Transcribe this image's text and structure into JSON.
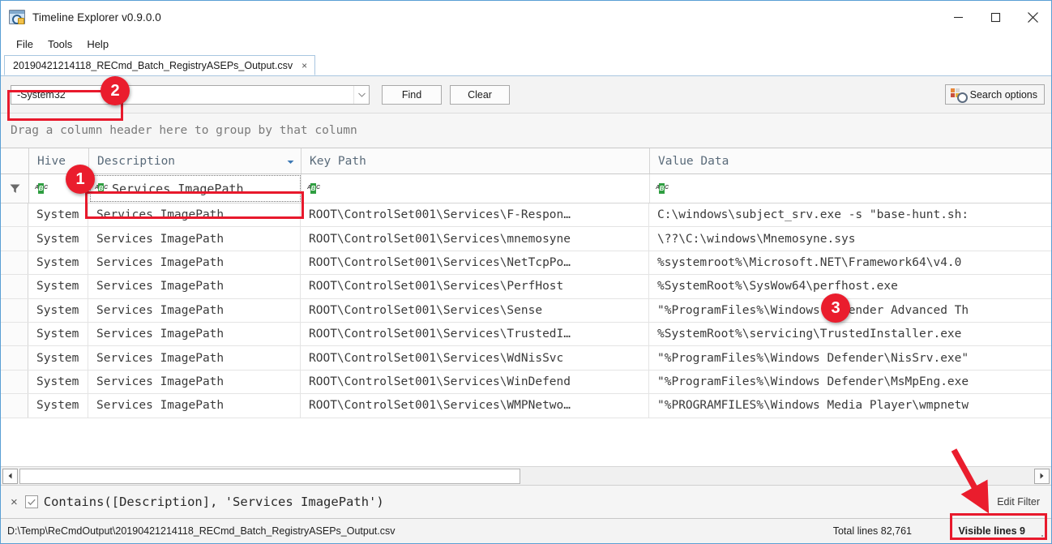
{
  "window": {
    "title": "Timeline Explorer v0.9.0.0",
    "app_icon": "timeline-explorer-icon",
    "minimize_label": "minimize-icon",
    "maximize_label": "maximize-icon",
    "close_label": "close-icon"
  },
  "menu": {
    "items": [
      {
        "label": "File"
      },
      {
        "label": "Tools"
      },
      {
        "label": "Help"
      }
    ]
  },
  "tabs": [
    {
      "label": "20190421214118_RECmd_Batch_RegistryASEPs_Output.csv",
      "close": "×"
    }
  ],
  "search": {
    "value": "-System32",
    "placeholder": "",
    "dropdown_icon": "chevron-down-icon",
    "find_label": "Find",
    "clear_label": "Clear",
    "options_label": "Search options",
    "options_icon": "search-options-icon"
  },
  "group_panel": {
    "hint": "Drag a column header here to group by that column"
  },
  "grid": {
    "columns": [
      {
        "key": "hive",
        "label": "Hive",
        "sorted": false
      },
      {
        "key": "desc",
        "label": "Description",
        "sorted": true,
        "sort_icon": "sort-descending-icon"
      },
      {
        "key": "key",
        "label": "Key Path",
        "sorted": false
      },
      {
        "key": "value",
        "label": "Value Data",
        "sorted": false
      }
    ],
    "filter_row": {
      "indicator_icon": "filter-funnel-icon",
      "cells": [
        {
          "icon": "abc-text-filter-icon",
          "value": ""
        },
        {
          "icon": "abc-text-filter-icon",
          "value": "Services ImagePath"
        },
        {
          "icon": "abc-text-filter-icon",
          "value": ""
        },
        {
          "icon": "abc-text-filter-icon",
          "value": ""
        }
      ]
    },
    "rows": [
      {
        "hive": "System",
        "desc": "Services ImagePath",
        "key": "ROOT\\ControlSet001\\Services\\F-Respon…",
        "value": "C:\\windows\\subject_srv.exe -s \"base-hunt.sh:"
      },
      {
        "hive": "System",
        "desc": "Services ImagePath",
        "key": "ROOT\\ControlSet001\\Services\\mnemosyne",
        "value": "\\??\\C:\\windows\\Mnemosyne.sys"
      },
      {
        "hive": "System",
        "desc": "Services ImagePath",
        "key": "ROOT\\ControlSet001\\Services\\NetTcpPo…",
        "value": "%systemroot%\\Microsoft.NET\\Framework64\\v4.0"
      },
      {
        "hive": "System",
        "desc": "Services ImagePath",
        "key": "ROOT\\ControlSet001\\Services\\PerfHost",
        "value": "%SystemRoot%\\SysWow64\\perfhost.exe"
      },
      {
        "hive": "System",
        "desc": "Services ImagePath",
        "key": "ROOT\\ControlSet001\\Services\\Sense",
        "value": "\"%ProgramFiles%\\Windows Defender Advanced Th"
      },
      {
        "hive": "System",
        "desc": "Services ImagePath",
        "key": "ROOT\\ControlSet001\\Services\\TrustedI…",
        "value": "%SystemRoot%\\servicing\\TrustedInstaller.exe"
      },
      {
        "hive": "System",
        "desc": "Services ImagePath",
        "key": "ROOT\\ControlSet001\\Services\\WdNisSvc",
        "value": "\"%ProgramFiles%\\Windows Defender\\NisSrv.exe\""
      },
      {
        "hive": "System",
        "desc": "Services ImagePath",
        "key": "ROOT\\ControlSet001\\Services\\WinDefend",
        "value": "\"%ProgramFiles%\\Windows Defender\\MsMpEng.exe"
      },
      {
        "hive": "System",
        "desc": "Services ImagePath",
        "key": "ROOT\\ControlSet001\\Services\\WMPNetwo…",
        "value": "\"%PROGRAMFILES%\\Windows Media Player\\wmpnetw"
      }
    ]
  },
  "hscrollbar": {
    "left_icon": "scroll-left-icon",
    "right_icon": "scroll-right-icon"
  },
  "filter_bar": {
    "close_icon": "×",
    "enabled": true,
    "check_icon": "✓",
    "expression": "Contains([Description], 'Services ImagePath')",
    "edit_label": "Edit Filter"
  },
  "status_bar": {
    "path": "D:\\Temp\\ReCmdOutput\\20190421214118_RECmd_Batch_RegistryASEPs_Output.csv",
    "total_lines": "Total lines 82,761",
    "visible_lines": "Visible lines 9",
    "grip_icon": "resize-grip-icon"
  },
  "annotations": {
    "accent_color": "#ea1d2d",
    "badges": [
      {
        "id": "1",
        "label": "1"
      },
      {
        "id": "2",
        "label": "2"
      },
      {
        "id": "3",
        "label": "3"
      }
    ],
    "arrow": "red-arrow-to-visible-lines"
  }
}
